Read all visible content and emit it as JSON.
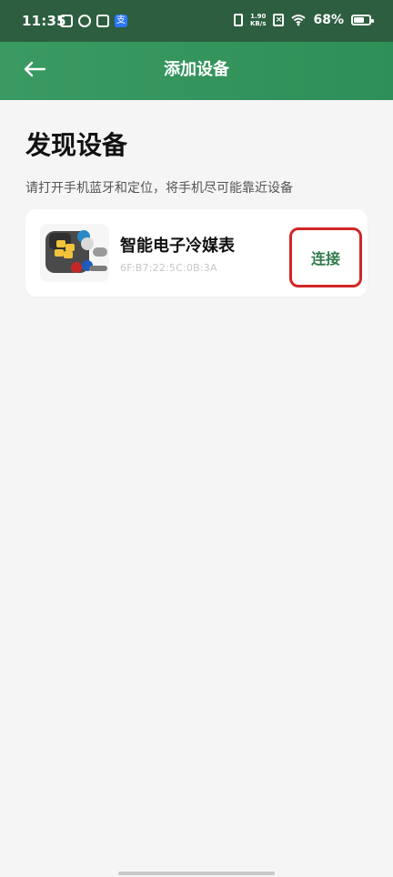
{
  "status_bar": {
    "time": "11:35",
    "network_speed_top": "1.90",
    "network_speed_unit": "KB/s",
    "battery_percent_text": "68%",
    "battery_level": 0.68
  },
  "header": {
    "title": "添加设备"
  },
  "page": {
    "heading": "发现设备",
    "subtitle": "请打开手机蓝牙和定位，将手机尽可能靠近设备"
  },
  "device": {
    "name": "智能电子冷媒表",
    "mac": "6F:B7:22:5C:0B:3A",
    "connect_label": "连接"
  },
  "colors": {
    "header_green": "#3a9a62",
    "status_green": "#2c5e3f",
    "connect_text": "#2f7b4b",
    "highlight_red": "#d32626"
  }
}
